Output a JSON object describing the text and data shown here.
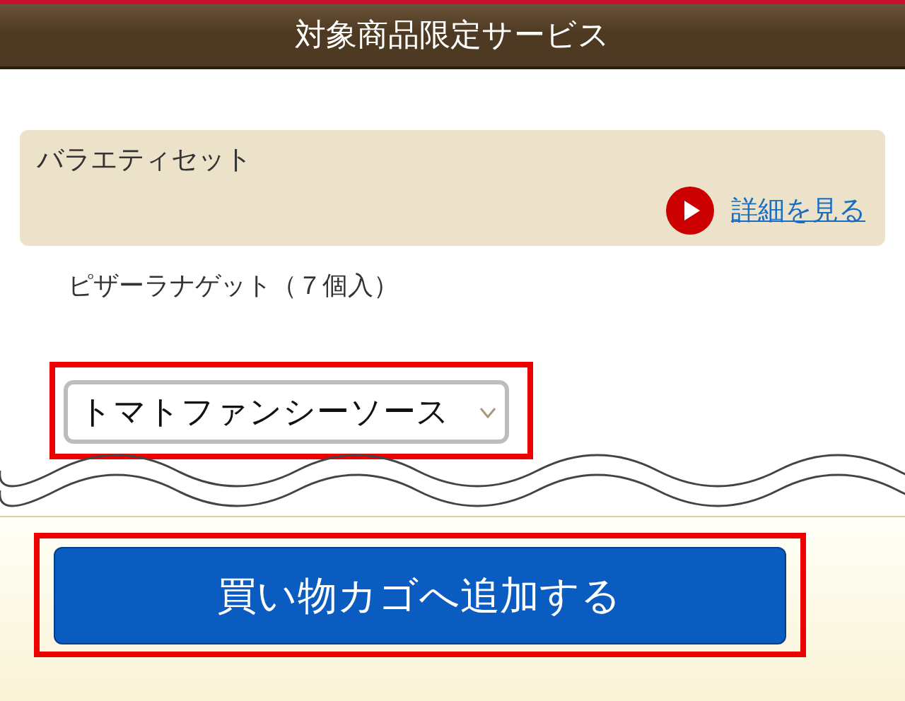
{
  "header": {
    "title": "対象商品限定サービス"
  },
  "product_card": {
    "title": "バラエティセット",
    "detail_link": "詳細を見る"
  },
  "item_description": "ピザーラナゲット（７個入）",
  "sauce_select": {
    "value": "トマトファンシーソース",
    "highlighted": true
  },
  "add_to_cart_button": {
    "label": "買い物カゴへ追加する",
    "highlighted": true
  }
}
